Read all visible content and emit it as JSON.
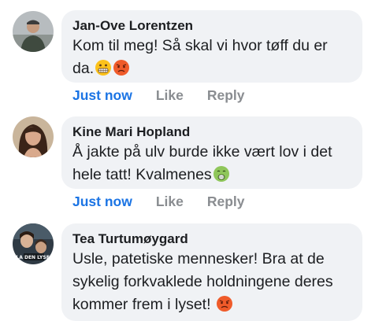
{
  "comments": [
    {
      "author": "Jan-Ove Lorentzen",
      "text": "Kom til meg! Så skal vi hvor tøff du er da.",
      "emojis": [
        "grimacing-face",
        "pouting-face"
      ],
      "time": "Just now",
      "like": "Like",
      "reply": "Reply"
    },
    {
      "author": "Kine Mari Hopland",
      "text": "Å jakte på ulv burde ikke vært lov i det hele tatt! Kvalmenes",
      "emojis": [
        "nauseated-face"
      ],
      "time": "Just now",
      "like": "Like",
      "reply": "Reply"
    },
    {
      "author": "Tea Turtumøygard",
      "text": "Usle, patetiske mennesker! Bra at de sykelig forkvaklede holdningene deres kommer frem i lyset!",
      "emojis": [
        "pouting-face"
      ],
      "avatar_text": "LA DEN LYSE!"
    }
  ],
  "colors": {
    "bubble": "#f0f2f5",
    "link": "#1b74e4",
    "muted": "#8a8d91",
    "text": "#1c1e21"
  }
}
